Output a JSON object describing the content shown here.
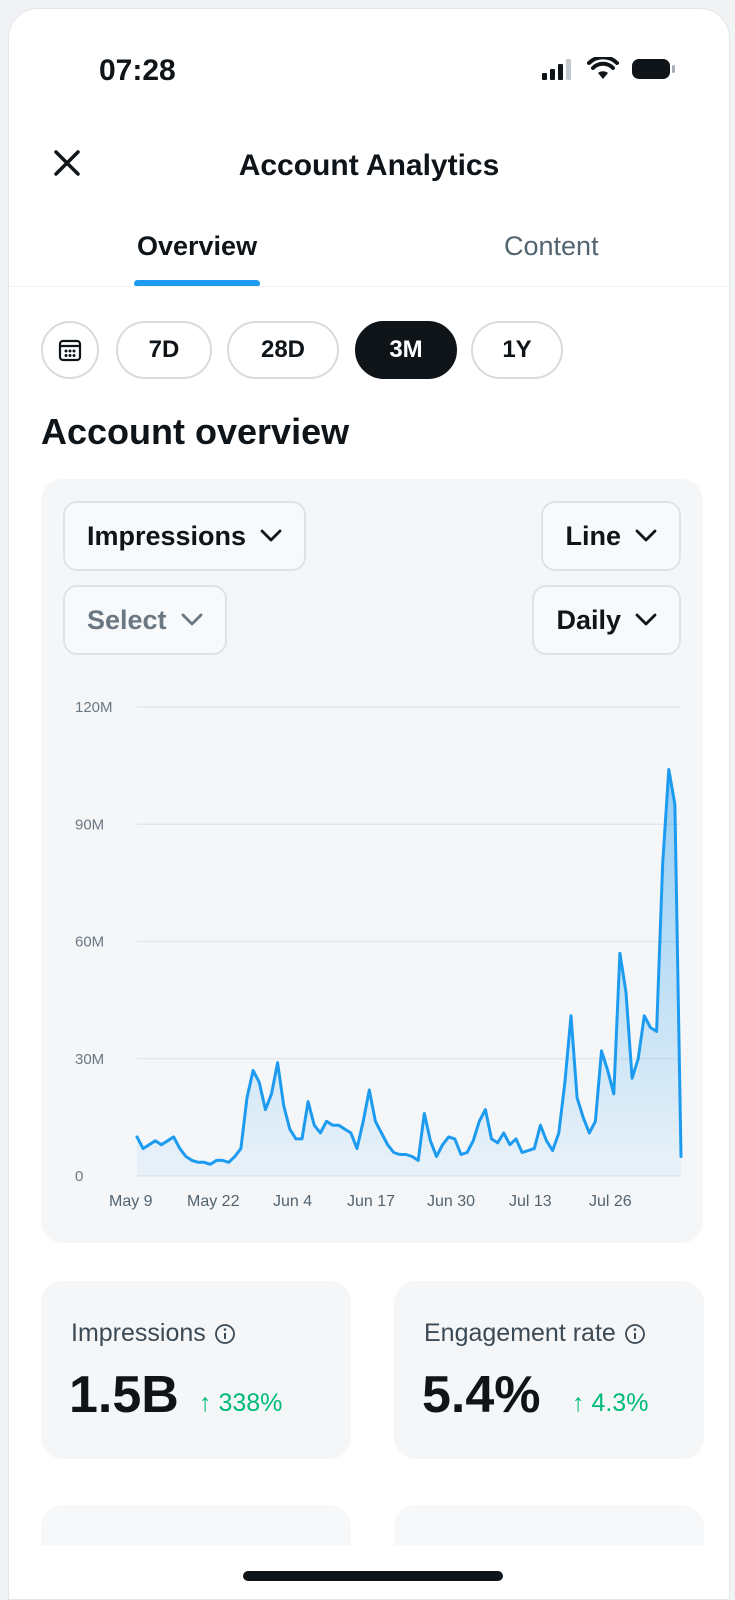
{
  "status_bar": {
    "time": "07:28"
  },
  "header": {
    "title": "Account Analytics"
  },
  "tabs": [
    {
      "label": "Overview",
      "active": true
    },
    {
      "label": "Content",
      "active": false
    }
  ],
  "range_pills": [
    {
      "label": "7D",
      "active": false
    },
    {
      "label": "28D",
      "active": false
    },
    {
      "label": "3M",
      "active": true
    },
    {
      "label": "1Y",
      "active": false
    }
  ],
  "section_title": "Account overview",
  "chart_controls": {
    "metric": "Impressions",
    "compare": "Select",
    "chart_type": "Line",
    "interval": "Daily"
  },
  "chart_data": {
    "type": "area",
    "y_ticks": [
      "0",
      "30M",
      "60M",
      "90M",
      "120M"
    ],
    "ylim": [
      0,
      120
    ],
    "x_ticks": [
      "May 9",
      "May 22",
      "Jun 4",
      "Jun 17",
      "Jun 30",
      "Jul 13",
      "Jul 26"
    ],
    "series": [
      {
        "color": "#1d9bf0",
        "values": [
          10,
          7,
          8,
          9,
          8,
          9,
          10,
          7,
          5,
          4,
          3.5,
          3.5,
          3,
          4,
          4,
          3.5,
          5,
          7,
          20,
          27,
          24,
          17,
          21,
          29,
          18,
          12,
          9.5,
          9.5,
          19,
          13,
          11,
          14,
          13,
          13,
          12,
          11,
          7,
          14,
          22,
          14,
          11,
          8,
          6,
          5.5,
          5.5,
          5,
          4,
          16,
          9,
          5,
          8,
          10,
          9.5,
          5.5,
          6,
          9,
          14,
          17,
          9.5,
          8.5,
          11,
          8,
          9.5,
          6,
          6.5,
          7,
          13,
          9,
          6.5,
          11,
          24,
          41,
          20,
          15,
          11,
          14,
          32,
          27,
          21,
          57,
          47,
          25,
          30,
          41,
          38,
          37,
          80,
          104,
          95,
          5
        ]
      }
    ]
  },
  "stats": [
    {
      "label": "Impressions",
      "value": "1.5B",
      "change": "↑ 338%"
    },
    {
      "label": "Engagement rate",
      "value": "5.4%",
      "change": "↑ 4.3%"
    }
  ]
}
